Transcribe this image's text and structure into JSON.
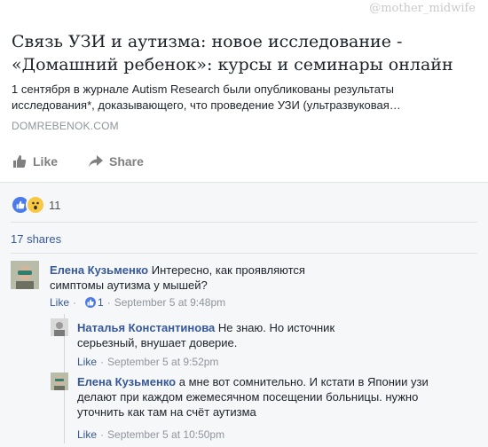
{
  "link_preview": {
    "watermark": "@mother_midwife",
    "title": "Связь УЗИ и аутизма: новое исследование - «Домашний ребенок»: курсы и семинары онлайн",
    "description": "1 сентября в журнале Autism Research были опубликованы результаты исследования*, доказывающего, что проведение УЗИ (ультразвуковая…",
    "domain": "DOMREBENOK.COM"
  },
  "actions": {
    "like_label": "Like",
    "share_label": "Share"
  },
  "reactions": {
    "count": "11",
    "icons": [
      "like-reaction-icon",
      "wow-reaction-icon"
    ]
  },
  "shares": "17 shares",
  "comments": [
    {
      "author": "Елена Кузьменко",
      "text": "Интересно, как проявляются симптомы аутизма у мышей?",
      "like_label": "Like",
      "likes": "1",
      "time": "September 5 at 9:48pm",
      "replies": [
        {
          "author": "Наталья Константинова",
          "text": "Не знаю. Но источник серьезный, внушает доверие.",
          "like_label": "Like",
          "time": "September 5 at 9:52pm"
        },
        {
          "author": "Елена Кузьменко",
          "text": "а мне вот сомнительно. И кстати в Японии узи делают при каждом ежемесячном посещении больницы. нужно уточнить как там на счёт аутизма",
          "like_label": "Like",
          "time": "September 5 at 10:50pm"
        }
      ]
    }
  ],
  "colors": {
    "link": "#365899",
    "meta": "#90949c",
    "background": "#f6f7f9",
    "like_blue": "#4a7be8"
  }
}
